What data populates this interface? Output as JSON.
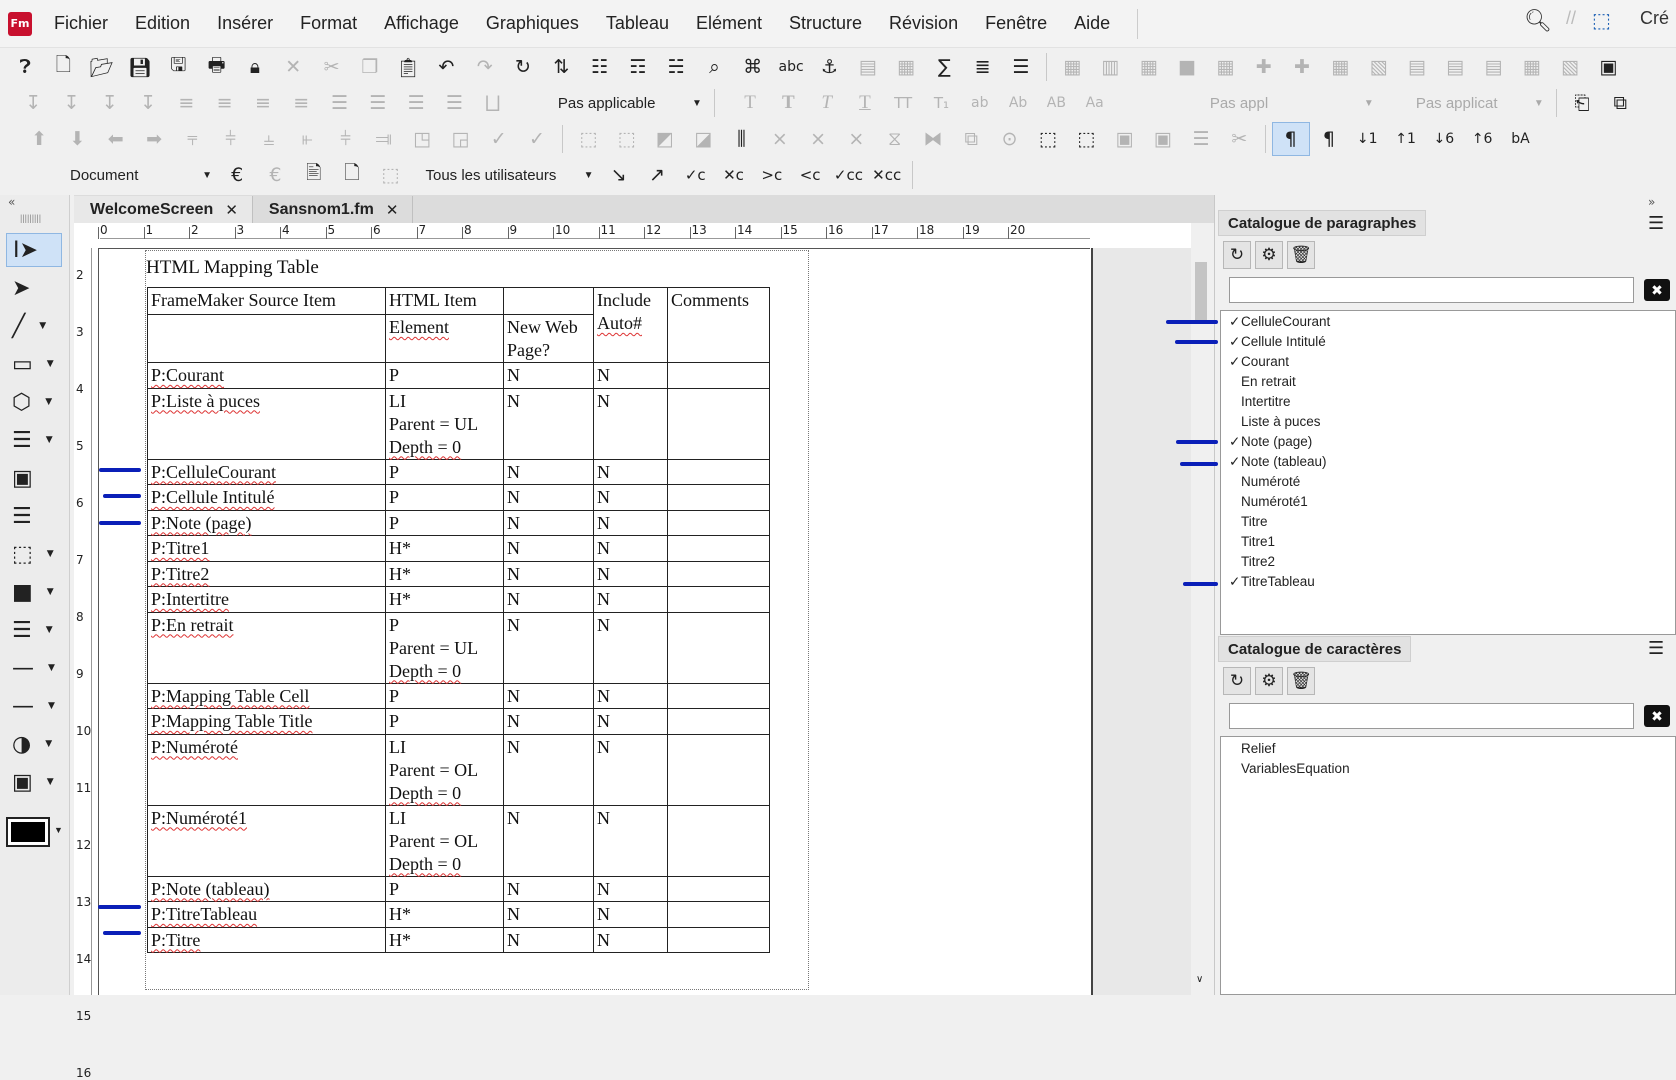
{
  "menubar": {
    "logo": "Fm",
    "items": [
      "Fichier",
      "Edition",
      "Insérer",
      "Format",
      "Affichage",
      "Graphiques",
      "Tableau",
      "Elément",
      "Structure",
      "Révision",
      "Fenêtre",
      "Aide"
    ],
    "right_label": "Cré"
  },
  "toolbar": {
    "paragraph_select": "Pas applicable",
    "char_select_1": "Pas appl",
    "char_select_2": "Pas applicat",
    "tracking_scope": "Document",
    "tracking_users": "Tous les utilisateurs"
  },
  "tabs": [
    {
      "label": "WelcomeScreen",
      "close": "✕"
    },
    {
      "label": "Sansnom1.fm",
      "close": "✕"
    }
  ],
  "ruler": {
    "h_ticks": [
      "0",
      "1",
      "2",
      "3",
      "4",
      "5",
      "6",
      "7",
      "8",
      "9",
      "10",
      "11",
      "12",
      "13",
      "14",
      "15",
      "16",
      "17",
      "18",
      "19",
      "20"
    ],
    "v_ticks": [
      "2",
      "3",
      "4",
      "5",
      "6",
      "7",
      "8",
      "9",
      "10",
      "11",
      "12",
      "13",
      "14",
      "15",
      "16"
    ]
  },
  "document": {
    "table_title": "HTML Mapping Table",
    "headers": {
      "source": "FrameMaker Source Item",
      "html_item": "HTML Item",
      "include": "Include",
      "comments": "Comments",
      "element": "Element",
      "new_web_page": "New Web Page?",
      "auto": "Auto#"
    },
    "rows": [
      {
        "source": "P:Courant",
        "element": [
          "P"
        ],
        "new_page": "N",
        "include_auto": "N",
        "comments": ""
      },
      {
        "source": "P:Liste à puces",
        "element": [
          "LI",
          "Parent = UL",
          "Depth = 0"
        ],
        "new_page": "N",
        "include_auto": "N",
        "comments": ""
      },
      {
        "source": "P:CelluleCourant",
        "element": [
          "P"
        ],
        "new_page": "N",
        "include_auto": "N",
        "comments": ""
      },
      {
        "source": "P:Cellule Intitulé",
        "element": [
          "P"
        ],
        "new_page": "N",
        "include_auto": "N",
        "comments": ""
      },
      {
        "source": "P:Note (page)",
        "element": [
          "P"
        ],
        "new_page": "N",
        "include_auto": "N",
        "comments": ""
      },
      {
        "source": "P:Titre1",
        "element": [
          "H*"
        ],
        "new_page": "N",
        "include_auto": "N",
        "comments": ""
      },
      {
        "source": "P:Titre2",
        "element": [
          "H*"
        ],
        "new_page": "N",
        "include_auto": "N",
        "comments": ""
      },
      {
        "source": "P:Intertitre",
        "element": [
          "H*"
        ],
        "new_page": "N",
        "include_auto": "N",
        "comments": ""
      },
      {
        "source": "P:En retrait",
        "element": [
          "P",
          "Parent = UL",
          "Depth = 0"
        ],
        "new_page": "N",
        "include_auto": "N",
        "comments": ""
      },
      {
        "source": "P:Mapping Table Cell",
        "element": [
          "P"
        ],
        "new_page": "N",
        "include_auto": "N",
        "comments": ""
      },
      {
        "source": "P:Mapping Table Title",
        "element": [
          "P"
        ],
        "new_page": "N",
        "include_auto": "N",
        "comments": ""
      },
      {
        "source": "P:Numéroté",
        "element": [
          "LI",
          "Parent = OL",
          "Depth = 0"
        ],
        "new_page": "N",
        "include_auto": "N",
        "comments": ""
      },
      {
        "source": "P:Numéroté1",
        "element": [
          "LI",
          "Parent = OL",
          "Depth = 0"
        ],
        "new_page": "N",
        "include_auto": "N",
        "comments": ""
      },
      {
        "source": "P:Note (tableau)",
        "element": [
          "P"
        ],
        "new_page": "N",
        "include_auto": "N",
        "comments": ""
      },
      {
        "source": "P:TitreTableau",
        "element": [
          "H*"
        ],
        "new_page": "N",
        "include_auto": "N",
        "comments": ""
      },
      {
        "source": "P:Titre",
        "element": [
          "H*"
        ],
        "new_page": "N",
        "include_auto": "N",
        "comments": ""
      }
    ]
  },
  "paragraph_catalog": {
    "title": "Catalogue de paragraphes",
    "search_value": "",
    "items": [
      {
        "name": "CelluleCourant",
        "check": "✓"
      },
      {
        "name": "Cellule Intitulé",
        "check": "✓"
      },
      {
        "name": "Courant",
        "check": "✓"
      },
      {
        "name": "En retrait",
        "check": ""
      },
      {
        "name": "Intertitre",
        "check": ""
      },
      {
        "name": "Liste à puces",
        "check": ""
      },
      {
        "name": "Note (page)",
        "check": "✓"
      },
      {
        "name": "Note (tableau)",
        "check": "✓"
      },
      {
        "name": "Numéroté",
        "check": ""
      },
      {
        "name": "Numéroté1",
        "check": ""
      },
      {
        "name": "Titre",
        "check": ""
      },
      {
        "name": "Titre1",
        "check": ""
      },
      {
        "name": "Titre2",
        "check": ""
      },
      {
        "name": "TitreTableau",
        "check": "✓"
      }
    ]
  },
  "character_catalog": {
    "title": "Catalogue de caractères",
    "search_value": "",
    "items": [
      "Relief",
      "VariablesEquation"
    ]
  },
  "colors": {
    "marker": "#0a1fb8",
    "selection": "#cfe2f7",
    "logo": "#c8102e"
  }
}
